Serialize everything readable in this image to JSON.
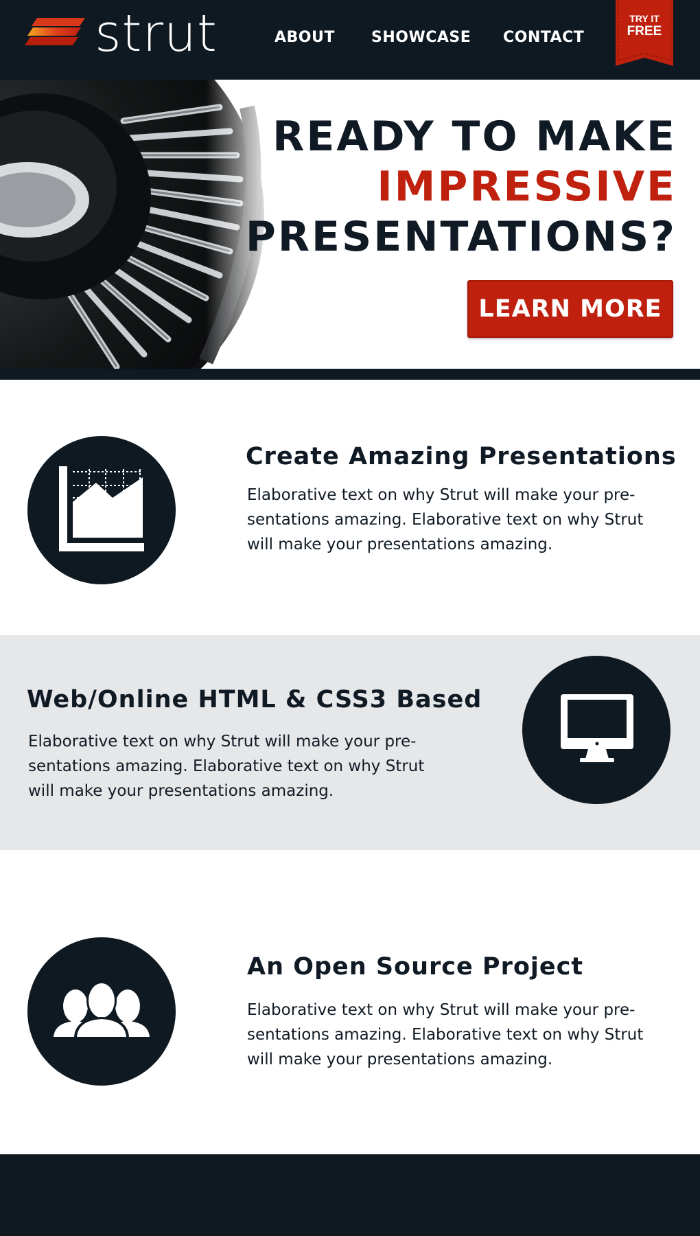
{
  "brand": {
    "name": "strut",
    "logo_colors": [
      "#f5a623",
      "#e2451a",
      "#b8200d"
    ]
  },
  "nav": {
    "items": [
      {
        "label": "ABOUT"
      },
      {
        "label": "SHOWCASE"
      },
      {
        "label": "CONTACT"
      }
    ]
  },
  "ribbon": {
    "small": "TRY IT",
    "big": "FREE",
    "color": "#c0210f"
  },
  "hero": {
    "line1": "READY TO MAKE",
    "line2": "IMPRESSIVE",
    "line3": "PRESENTATIONS?",
    "accent_color": "#c0210f",
    "button_label": "LEARN MORE",
    "image_icon": "turbine-wheel-image"
  },
  "features": [
    {
      "title": "Create Amazing Presentations",
      "text": "Elaborative text on why Strut will make your pre-sentations amazing. Elaborative text on why Strut will make your presentations amazing.",
      "icon": "area-chart-icon"
    },
    {
      "title": "Web/Online HTML & CSS3 Based",
      "text": "Elaborative text on why Strut will make your pre-sentations amazing. Elaborative text on why Strut will make your presentations amazing.",
      "icon": "monitor-icon"
    },
    {
      "title": "An Open Source Project",
      "text": "Elaborative text on why Strut will make your pre-sentations amazing. Elaborative text on why Strut will make your presentations amazing.",
      "icon": "people-group-icon"
    }
  ],
  "colors": {
    "dark": "#0f1922",
    "accent": "#c0210f",
    "band": "#e6e7e9"
  }
}
